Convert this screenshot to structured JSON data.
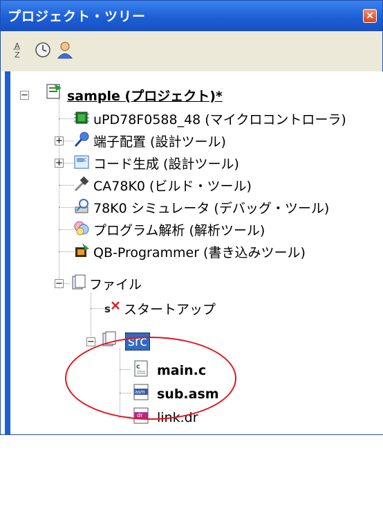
{
  "panel": {
    "title": "プロジェクト・ツリー",
    "close_glyph": "×"
  },
  "toolbar": {
    "buttons": [
      "sort-az-icon",
      "history-icon",
      "user-icon"
    ]
  },
  "tree": {
    "project": "sample (プロジェクト)*",
    "items": [
      "uPD78F0588_48 (マイクロコントローラ)",
      "端子配置 (設計ツール)",
      "コード生成 (設計ツール)",
      "CA78K0 (ビルド・ツール)",
      "78K0 シミュレータ (デバッグ・ツール)",
      "プログラム解析 (解析ツール)",
      "QB-Programmer (書き込みツール)"
    ],
    "files": "ファイル",
    "startup": "スタートアップ",
    "src": "src",
    "main": "main.c",
    "sub": "sub.asm",
    "link": "link.dr"
  },
  "colors": {
    "title_bar": "#1d5fd6",
    "selection": "#316ac5",
    "annotation": "#e0141a"
  }
}
